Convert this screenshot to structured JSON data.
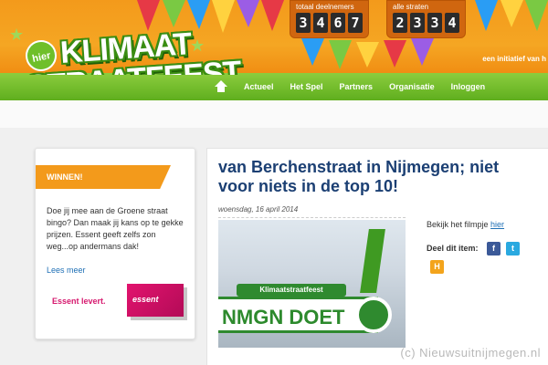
{
  "header": {
    "logo": {
      "badge": "hier",
      "line1": "KLIMAAT",
      "line2": "STRAATFEEST"
    },
    "counters": [
      {
        "label": "totaal deelnemers",
        "digits": [
          "3",
          "4",
          "6",
          "7"
        ]
      },
      {
        "label": "alle straten",
        "digits": [
          "2",
          "3",
          "3",
          "4"
        ]
      }
    ],
    "tagline": "een initiatief van h"
  },
  "nav": {
    "items": [
      {
        "label": "Actueel"
      },
      {
        "label": "Het Spel"
      },
      {
        "label": "Partners"
      },
      {
        "label": "Organisatie"
      },
      {
        "label": "Inloggen"
      }
    ]
  },
  "sidebar": {
    "ribbon": "WINNEN!",
    "text": "Doe jij mee aan de Groene straat bingo? Dan maak jij kans op te gekke prijzen. Essent geeft zelfs zon weg...op andermans dak!",
    "link": "Lees meer",
    "sponsor_label": "Essent levert.",
    "sponsor_logo": "essent"
  },
  "article": {
    "title": "van Berchenstraat in Nijmegen; niet voor niets in de top 10!",
    "date": "woensdag, 16 april 2014",
    "video": {
      "badge": "Klimaatstraatfeest",
      "text": "NMGN DOET"
    },
    "film_text": "Bekijk het filmpje",
    "film_link": "hier",
    "share_label": "Deel dit item:",
    "share_icons": [
      {
        "name": "facebook-icon",
        "glyph": "f",
        "color": "#3b5998"
      },
      {
        "name": "twitter-icon",
        "glyph": "t",
        "color": "#2aa9e0"
      },
      {
        "name": "hyves-icon",
        "glyph": "H",
        "color": "#f3a41c"
      }
    ]
  },
  "watermark": "(c) Nieuwsuitnijmegen.nl",
  "colors": {
    "header_orange": "#f5a623",
    "nav_green": "#6fbf2a",
    "title_blue": "#1b3f73",
    "essent_pink": "#e2136e"
  }
}
